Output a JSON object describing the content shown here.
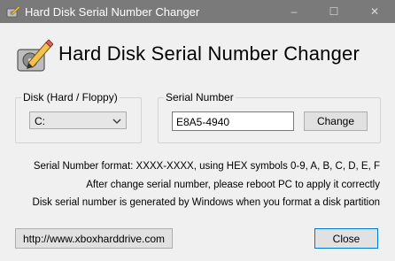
{
  "window": {
    "title": "Hard Disk Serial Number Changer",
    "controls": {
      "minimize": "–",
      "maximize": "☐",
      "close": "✕"
    }
  },
  "header": {
    "title": "Hard Disk Serial Number Changer",
    "logo_icon": "disk-pencil-icon"
  },
  "disk_group": {
    "label": "Disk (Hard / Floppy)",
    "selected": "C:"
  },
  "serial_group": {
    "label": "Serial Number",
    "value": "E8A5-4940",
    "change_button": "Change"
  },
  "info": {
    "line1": "Serial Number format: XXXX-XXXX, using HEX symbols 0-9, A, B, C, D, E, F",
    "line2": "After change serial number, please reboot PC to apply it correctly",
    "line3": "Disk serial number is generated by Windows when you format a disk partition"
  },
  "footer": {
    "url_button": "http://www.xboxharddrive.com",
    "close_button": "Close"
  },
  "colors": {
    "titlebar": "#7a7a7a",
    "window_bg": "#f0f0f0",
    "accent": "#0078d7"
  }
}
